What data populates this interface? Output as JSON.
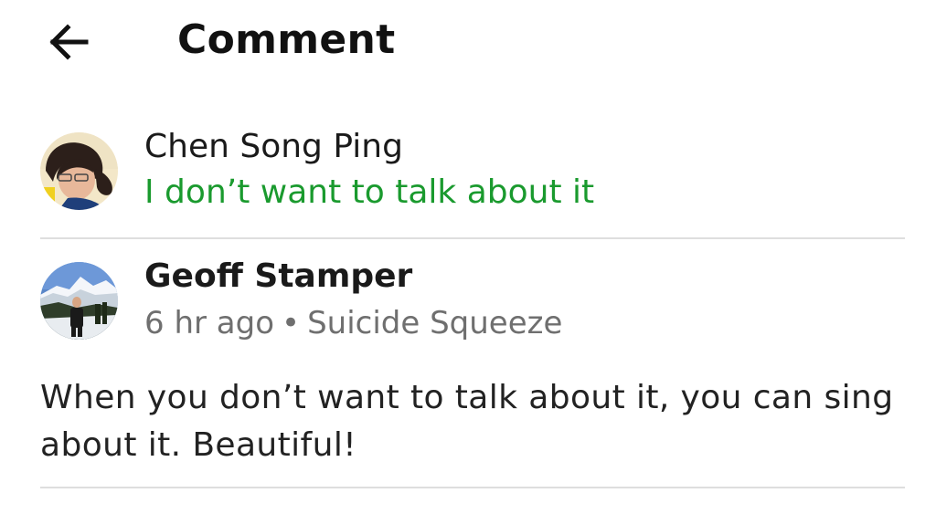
{
  "header": {
    "title": "Comment",
    "back_icon": "arrow-left-icon"
  },
  "original_post": {
    "author": "Chen Song Ping",
    "text": "I don’t want to talk about it",
    "text_color": "#1a9a2e"
  },
  "comment": {
    "author": "Geoff Stamper",
    "time": "6 hr ago",
    "separator": "•",
    "context": "Suicide Squeeze",
    "body": "When you don’t want to talk about it, you can sing about it. Beautiful!"
  },
  "colors": {
    "accent_green": "#1a9a2e",
    "meta_gray": "#6f6f6f",
    "divider": "#dedede"
  }
}
